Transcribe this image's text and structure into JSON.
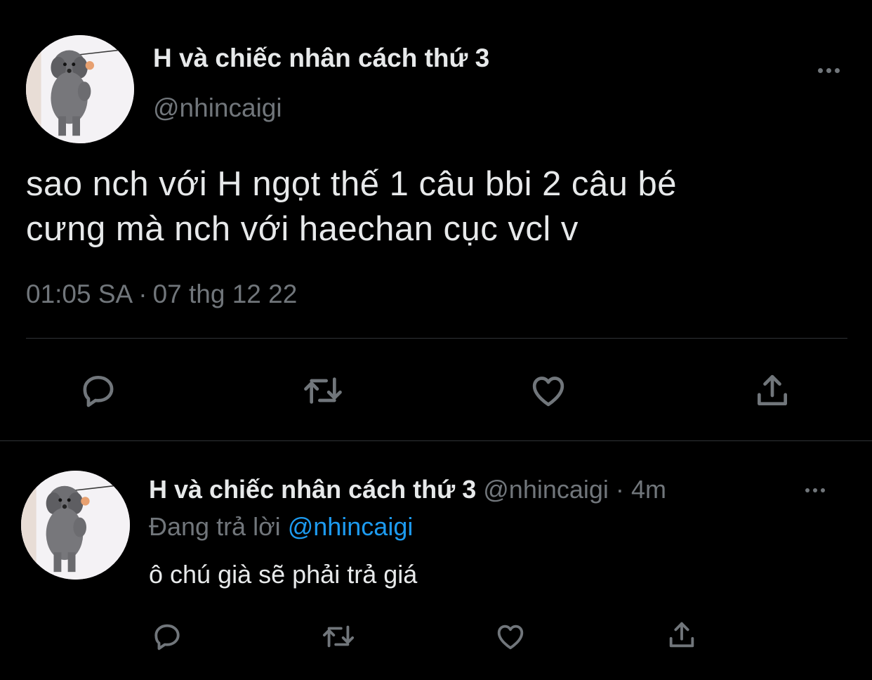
{
  "main_tweet": {
    "display_name": "H và chiếc nhân cách thứ 3",
    "handle": "@nhincaigi",
    "more_icon": "more-horizontal-icon",
    "text_line1": "sao nch với H ngọt thế 1 câu bbi 2 câu bé",
    "text_line2": "cưng mà nch với haechan cục vcl v",
    "time": "01:05 SA",
    "separator": "·",
    "date": "07 thg 12 22",
    "actions": [
      "reply-icon",
      "retweet-icon",
      "like-icon",
      "share-icon"
    ]
  },
  "reply_tweet": {
    "display_name": "H và chiếc nhân cách thứ 3",
    "handle": "@nhincaigi",
    "separator": "·",
    "time_ago": "4m",
    "replying_label": "Đang trả lời",
    "replying_to": "@nhincaigi",
    "text": "ô chú già sẽ phải trả giá",
    "more_icon": "more-horizontal-icon",
    "actions": [
      "reply-icon",
      "retweet-icon",
      "like-icon",
      "share-icon"
    ]
  },
  "colors": {
    "background": "#000000",
    "primary_text": "#e7e9ea",
    "secondary_text": "#71767b",
    "link": "#1d9bf0",
    "divider": "#2f3336"
  }
}
